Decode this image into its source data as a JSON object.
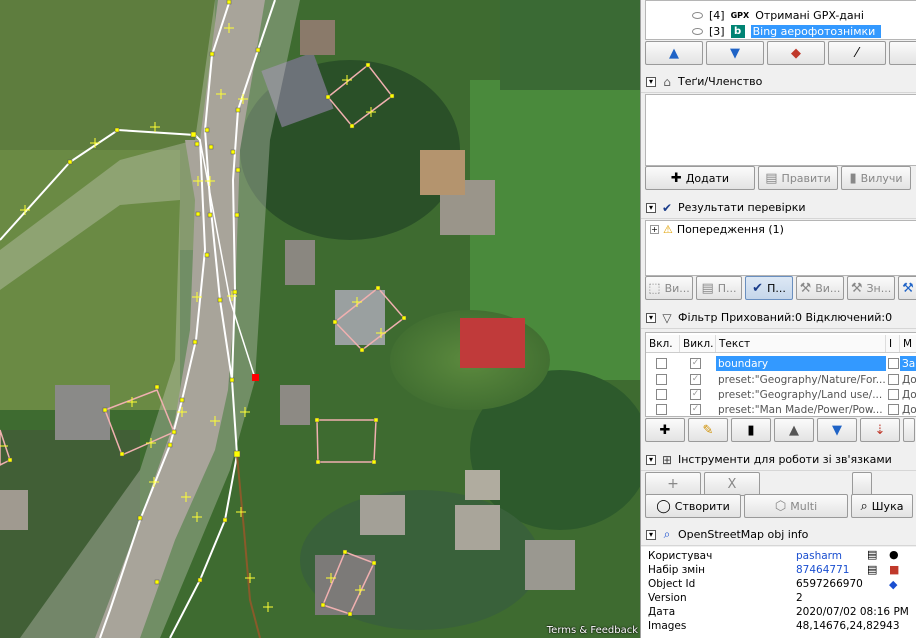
{
  "map": {
    "attribution": "Terms & Feedback"
  },
  "layers": {
    "items": [
      {
        "index": "[4]",
        "prefix": "GPX",
        "name": "Отримані GPX-дані",
        "selected": false
      },
      {
        "index": "[3]",
        "prefix": "b",
        "name": "Bing аерофотознімки",
        "selected": true
      }
    ],
    "buttons": [
      "arrow-up-icon",
      "arrow-down-icon",
      "layer-merge-icon",
      "magic-wand-icon",
      "blank-icon"
    ]
  },
  "tags": {
    "title": "Теґи/Членство",
    "buttons": {
      "add": "Додати",
      "edit": "Правити",
      "delete": "Вилучи"
    }
  },
  "validation": {
    "title": "Результати перевірки",
    "tree_item": "Попередження (1)",
    "buttons": {
      "b1": "Ви...",
      "b2": "П...",
      "b3": "П...",
      "b4": "Ви...",
      "b5": "Зн..."
    }
  },
  "filter": {
    "title": "Фільтр Прихований:0 Відключений:0",
    "columns": {
      "enabled": "Вкл.",
      "hidden": "Викл.",
      "text": "Текст",
      "inverted": "I",
      "mode": "M"
    },
    "rows": [
      {
        "text": "boundary",
        "mode": "За...",
        "selected": true
      },
      {
        "text": "preset:\"Geography/Nature/For...",
        "mode": "Дод",
        "selected": false
      },
      {
        "text": "preset:\"Geography/Land use/...",
        "mode": "Дод",
        "selected": false
      },
      {
        "text": "preset:\"Man Made/Power/Pow...",
        "mode": "Дод",
        "selected": false
      }
    ]
  },
  "relations": {
    "title": "Інструменти для роботи зі зв'язками",
    "buttons": {
      "add": "+",
      "remove": "X",
      "create": "Створити",
      "multi": "Multi",
      "search": "Шука"
    }
  },
  "obj_info": {
    "title": "OpenStreetMap obj info",
    "rows": [
      {
        "key": "Користувач",
        "value": "pasharm",
        "link": true
      },
      {
        "key": "Набір змін",
        "value": "87464771",
        "link": true
      },
      {
        "key": "Object Id",
        "value": "6597266970",
        "link": false
      },
      {
        "key": "Version",
        "value": "2",
        "link": false
      },
      {
        "key": "Дата",
        "value": "2020/07/02 08:16 PM",
        "link": false
      },
      {
        "key": "Images",
        "value": "48,14676,24,82943",
        "link": false
      }
    ]
  },
  "colors": {
    "selection": "#3399ff",
    "link": "#1a4fd0",
    "way": "#ffffff",
    "node": "#ffff00",
    "building": "#f0b0b0",
    "selected_node": "#ff0000"
  }
}
